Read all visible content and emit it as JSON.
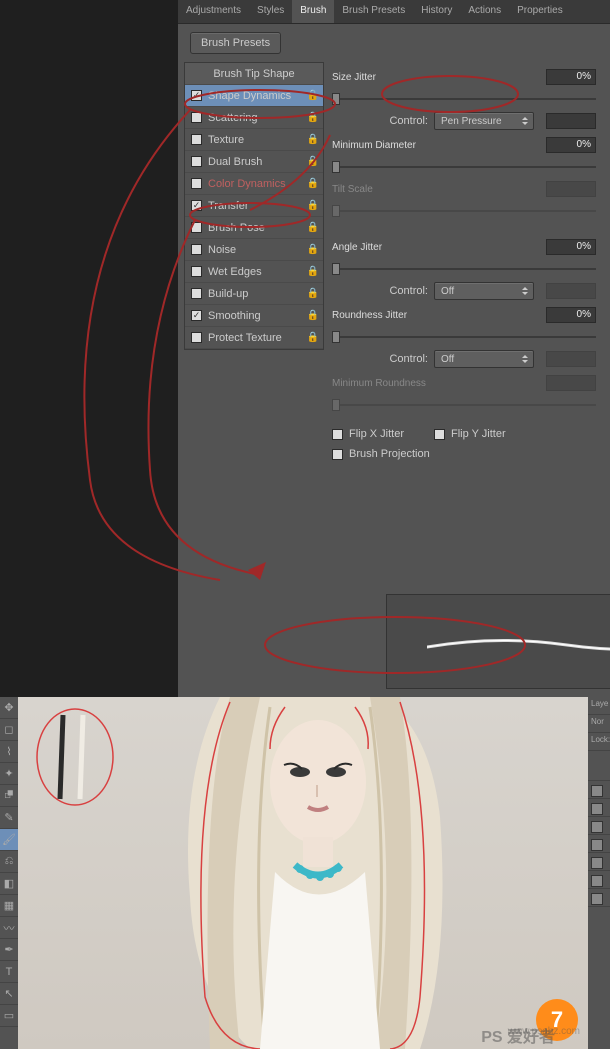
{
  "tabs": {
    "t0": "Adjustments",
    "t1": "Styles",
    "t2": "Brush",
    "t3": "Brush Presets",
    "t4": "History",
    "t5": "Actions",
    "t6": "Properties"
  },
  "topButton": "Brush Presets",
  "list": {
    "i0": "Brush Tip Shape",
    "i1": "Shape Dynamics",
    "i2": "Scattering",
    "i3": "Texture",
    "i4": "Dual Brush",
    "i5": "Color Dynamics",
    "i6": "Transfer",
    "i7": "Brush Pose",
    "i8": "Noise",
    "i9": "Wet Edges",
    "i10": "Build-up",
    "i11": "Smoothing",
    "i12": "Protect Texture"
  },
  "checks": {
    "i1": "✓",
    "i6": "✓",
    "i11": "✓"
  },
  "right": {
    "sizeJitter": "Size Jitter",
    "sizeJitterVal": "0%",
    "control": "Control:",
    "penPressure": "Pen Pressure",
    "minDiam": "Minimum Diameter",
    "minDiamVal": "0%",
    "tiltScale": "Tilt Scale",
    "angleJitter": "Angle Jitter",
    "angleJitterVal": "0%",
    "off": "Off",
    "roundJitter": "Roundness Jitter",
    "roundJitterVal": "0%",
    "minRound": "Minimum Roundness",
    "flipX": "Flip X Jitter",
    "flipY": "Flip Y Jitter",
    "brushProj": "Brush Projection"
  },
  "photo": {
    "layersTab": "Laye",
    "mode": "Nor",
    "lock": "Lock:",
    "badge": "7",
    "wm": "PS 爱好者",
    "url": "www.psahz.com"
  }
}
